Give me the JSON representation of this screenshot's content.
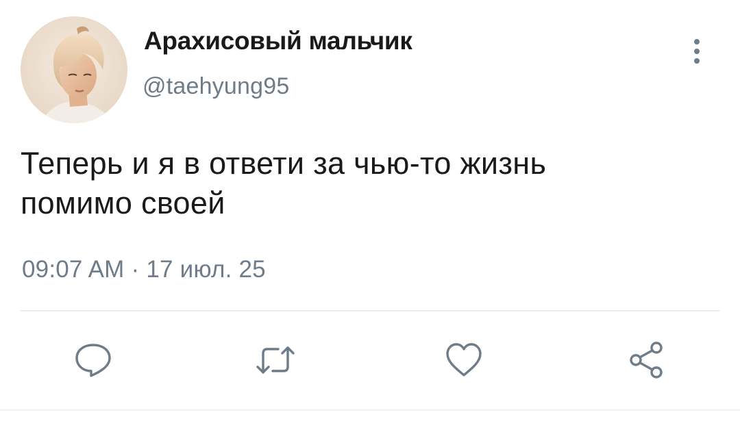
{
  "user": {
    "display_name": "Арахисовый мальчик",
    "username": "@taehyung95",
    "avatar_icon": "avatar-photo"
  },
  "tweet": {
    "text_lines": [
      "Теперь и я в ответи за чью-то жизнь",
      "помимо своей"
    ],
    "time": "09:07 AM",
    "separator": "·",
    "date": "17 июл. 25"
  },
  "actions": {
    "reply_icon": "reply-icon",
    "retweet_icon": "retweet-icon",
    "like_icon": "heart-icon",
    "share_icon": "share-icon"
  },
  "colors": {
    "text_primary": "#1a1a1a",
    "text_secondary": "#6e7c89",
    "divider": "#e6ecf0"
  }
}
